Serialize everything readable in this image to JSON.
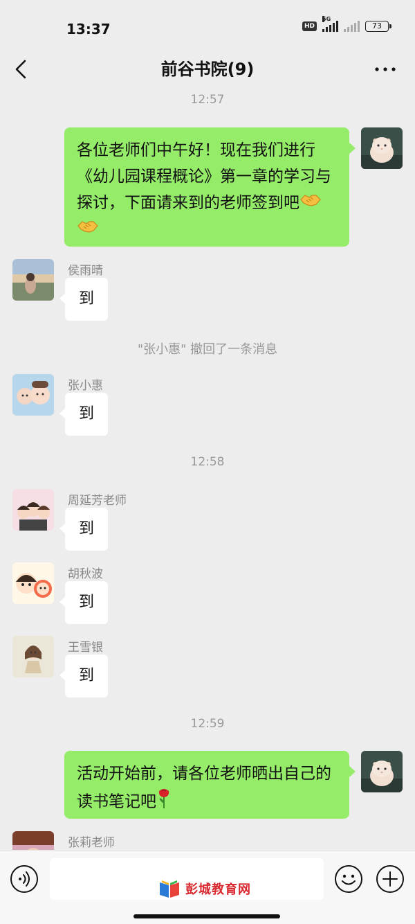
{
  "status_bar": {
    "time": "13:37",
    "hd": "HD",
    "network": "5G",
    "battery": "73"
  },
  "nav": {
    "title": "前谷书院(9)"
  },
  "chat": {
    "time_separators": [
      "12:57",
      "12:58",
      "12:59"
    ],
    "recall_notice": "\"张小惠\" 撤回了一条消息",
    "outgoing_messages": [
      {
        "text": "各位老师们中午好！现在我们进行《幼儿园课程概论》第一章的学习与探讨，下面请来到的老师签到吧",
        "emoji": [
          "handshake",
          "handshake"
        ]
      },
      {
        "text": "活动开始前，请各位老师晒出自己的读书笔记吧",
        "emoji": [
          "rose"
        ]
      }
    ],
    "incoming_messages": [
      {
        "sender": "侯雨晴",
        "text": "到"
      },
      {
        "sender": "张小惠",
        "text": "到"
      },
      {
        "sender": "周延芳老师",
        "text": "到"
      },
      {
        "sender": "胡秋波",
        "text": "到"
      },
      {
        "sender": "王雪银",
        "text": "到"
      }
    ],
    "partial_sender": "张莉老师"
  },
  "input_bar": {
    "watermark": "彭城教育网",
    "icons": {
      "voice": "voice-icon",
      "emoji": "emoji-icon",
      "plus": "plus-icon"
    }
  },
  "colors": {
    "background": "#ededed",
    "outgoing_bubble": "#95ec69",
    "incoming_bubble": "#ffffff",
    "meta_text": "#999999"
  }
}
